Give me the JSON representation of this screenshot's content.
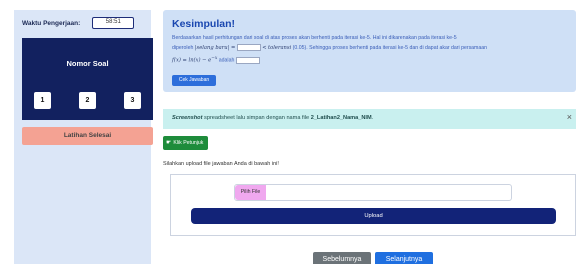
{
  "timer": {
    "label": "Waktu Pengerjaan:",
    "value": "58:51"
  },
  "sidebar": {
    "panel_title": "Nomor Soal",
    "numbers": [
      "1",
      "2",
      "3"
    ],
    "finish_label": "Latihan Selesai"
  },
  "kesimpulan": {
    "title": "Kesimpulan!",
    "line1": "Berdasarkan hasil perhitungan dari soal di atas proses akan berhenti pada iterasi ke-5. Hal ini dikarenakan pada iterasi ke-5",
    "line2_pre": "diperoleh",
    "line2_math": "|selang baru| =",
    "line2_mid": "<",
    "line2_tol": "toleransi",
    "line2_post": "(0.05). Sehingga proses berhenti pada iterasi ke-5 dan di dapat akar dari persamaan",
    "line3_math": "f(x) = ln(x) − e",
    "line3_sup": "−x",
    "line3_post": "adalah",
    "check_label": "Cek Jawaban"
  },
  "alert": {
    "prefix": "Screenshot",
    "text": "spreadsheet lalu simpan dengan nama file",
    "filename": "2_Latihan2_Nama_NIM",
    "close_glyph": "×"
  },
  "petunjuk": {
    "label": "Klik Petunjuk",
    "icon": "pointing-hand-icon"
  },
  "upload": {
    "instruction": "Silahkan upload file jawaban Anda di bawah ini!",
    "pick_label": "Pilih File",
    "button_label": "Upload"
  },
  "nav": {
    "prev_label": "Sebelumnya",
    "next_label": "Selanjutnya"
  },
  "colors": {
    "sidebar_bg": "#dbe6f7",
    "soal_panel": "#12215f",
    "finish": "#f4a293",
    "kesimpulan_bg": "#cfe0f6",
    "alert_bg": "#c9f0ef",
    "petunjuk": "#1e8c3b",
    "upload": "#122378",
    "prev": "#6b7378",
    "next": "#1f6fe0"
  }
}
